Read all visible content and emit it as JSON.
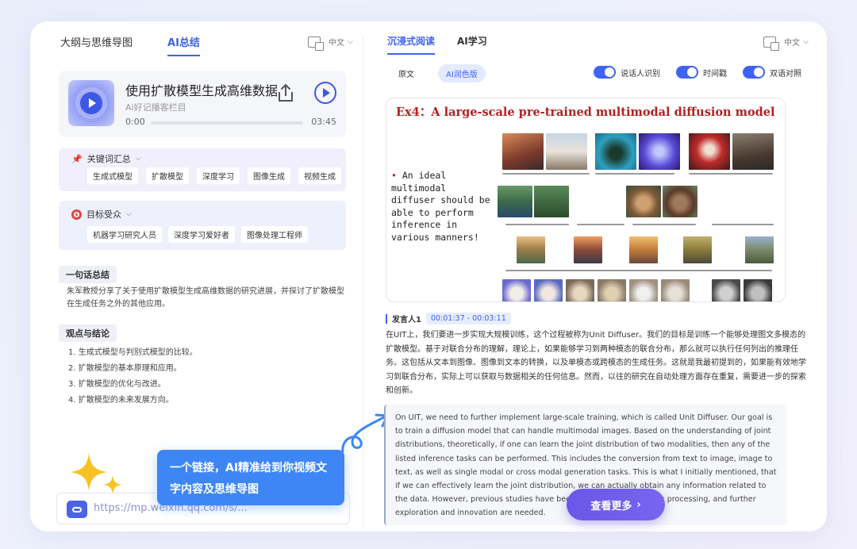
{
  "left": {
    "tabs": [
      {
        "label": "大纲与思维导图"
      },
      {
        "label": "AI总结"
      }
    ],
    "language": "中文",
    "player": {
      "title": "使用扩散模型生成高维数据",
      "subtitle": "Ai好记播客栏目",
      "time_current": "0:00",
      "time_total": "03:45",
      "progress": 0
    },
    "keywords": {
      "heading": "关键词汇总",
      "items": [
        "生成式模型",
        "扩散模型",
        "深度学习",
        "图像生成",
        "视频生成"
      ]
    },
    "audience": {
      "heading": "目标受众",
      "items": [
        "机器学习研究人员",
        "深度学习爱好者",
        "图像处理工程师"
      ]
    },
    "summary": {
      "label": "一句话总结",
      "text": "朱军教授分享了关于使用扩散模型生成高维数据的研究进展，并探讨了扩散模型在生成任务之外的其他应用。"
    },
    "conclusions": {
      "label": "观点与结论",
      "items": [
        "1. 生成式模型与判别式模型的比较。",
        "2. 扩散模型的基本原理和应用。",
        "3. 扩散模型的优化与改进。",
        "4. 扩散模型的未来发展方向。"
      ]
    },
    "callout": "一个链接，AI精准给到你视频文字内容及思维导图",
    "link": "https://mp.weixin.qq.com/s/..."
  },
  "right": {
    "tabs": [
      {
        "label": "沉浸式阅读"
      },
      {
        "label": "AI学习"
      }
    ],
    "language": "中文",
    "subtabs": [
      {
        "label": "原文"
      },
      {
        "label": "AI润色版"
      }
    ],
    "toggles": [
      {
        "label": "说话人识别"
      },
      {
        "label": "时间戳"
      },
      {
        "label": "双语对照"
      }
    ],
    "slide": {
      "title": "Ex4：A large-scale pre-trained multimodal diffusion model",
      "bullet": "An ideal multimodal diffuser should be able to perform inference in various manners!"
    },
    "speaker": {
      "name": "发言人1",
      "time": "00:01:37 - 00:03:11"
    },
    "zh_text": "在UIT上，我们要进一步实现大规模训练，这个过程被称为Unit Diffuser。我们的目标是训练一个能够处理图文多模态的扩散模型。基于对联合分布的理解，理论上，如果能够学习到两种模态的联合分布，那么就可以执行任何列出的推理任务。这包括从文本到图像、图像到文本的转换，以及单模态或跨模态的生成任务。这就是我最初提到的，如果能有效地学习到联合分布，实际上可以获取与数据相关的任何信息。然而，以往的研究在自动处理方面存在重复，需要进一步的探索和创新。",
    "en_text": "On UIT, we need to further implement large-scale training, which is called Unit Diffuser. Our goal is to train a diffusion model that can handle multimodal images. Based on the understanding of joint distributions, theoretically, if one can learn the joint distribution of two modalities, then any of the listed inference tasks can be performed. This includes the conversion from text to image, image to text, as well as single modal or cross modal generation tasks. This is what I initially mentioned, that if we can effectively learn the joint distribution, we can actually obtain any information related to the data. However, previous studies have been repetitive in automatic processing, and further exploration and innovation are needed.",
    "more_button": "查看更多"
  },
  "colors": {
    "accent": "#3e63f0",
    "callout": "#3e86f5",
    "more_button": "#6a56e8",
    "slide_title": "#b51f1f"
  }
}
